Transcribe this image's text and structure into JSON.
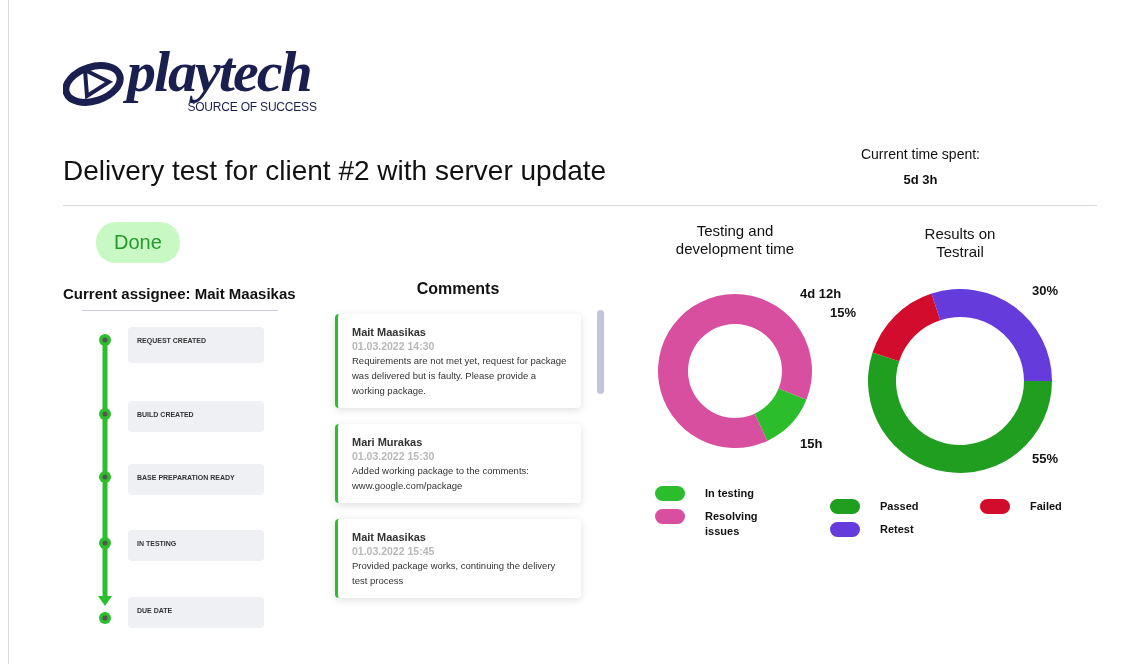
{
  "logo": {
    "wordmark": "playtech",
    "tagline": "SOURCE OF SUCCESS"
  },
  "title": "Delivery test for client #2 with server update",
  "time_spent": {
    "label": "Current time spent:",
    "value": "5d 3h"
  },
  "status": {
    "label": "Done"
  },
  "assignee": "Current assignee: Mait Maasikas",
  "timeline": [
    {
      "label": "REQUEST CREATED"
    },
    {
      "label": "BUILD CREATED"
    },
    {
      "label": "BASE PREPARATION READY"
    },
    {
      "label": "IN TESTING"
    },
    {
      "label": "DUE DATE"
    }
  ],
  "comments": {
    "title": "Comments",
    "items": [
      {
        "author": "Mait Maasikas",
        "time": "01.03.2022 14:30",
        "text": "Requirements are not met yet, request for package was delivered but is faulty. Please provide a working package."
      },
      {
        "author": "Mari Murakas",
        "time": "01.03.2022 15:30",
        "text": "Added working package to the comments: www.google.com/package"
      },
      {
        "author": "Mait Maasikas",
        "time": "01.03.2022 15:45",
        "text": "Provided package works, continuing the delivery test process"
      }
    ]
  },
  "charts": [
    {
      "chart_data": {
        "type": "donut",
        "title": "Testing and development time",
        "series": [
          {
            "values": [
              12,
              88
            ]
          }
        ],
        "value_labels": [
          "15h",
          "4d 12h"
        ]
      },
      "legend": [
        {
          "label": "In testing",
          "color": "#2bbd2b"
        },
        {
          "label": "Resolving issues",
          "color": "#d94f9f"
        }
      ]
    },
    {
      "chart_data": {
        "type": "donut",
        "title": "Results on Testrail",
        "series": [
          {
            "values": [
              55,
              15,
              30
            ]
          }
        ],
        "value_labels": [
          "55%",
          "15%",
          "30%"
        ]
      },
      "legend": [
        {
          "label": "Passed",
          "color": "#1f9e1f"
        },
        {
          "label": "Failed",
          "color": "#d20c2c"
        },
        {
          "label": "Retest",
          "color": "#653bdb"
        }
      ]
    }
  ]
}
